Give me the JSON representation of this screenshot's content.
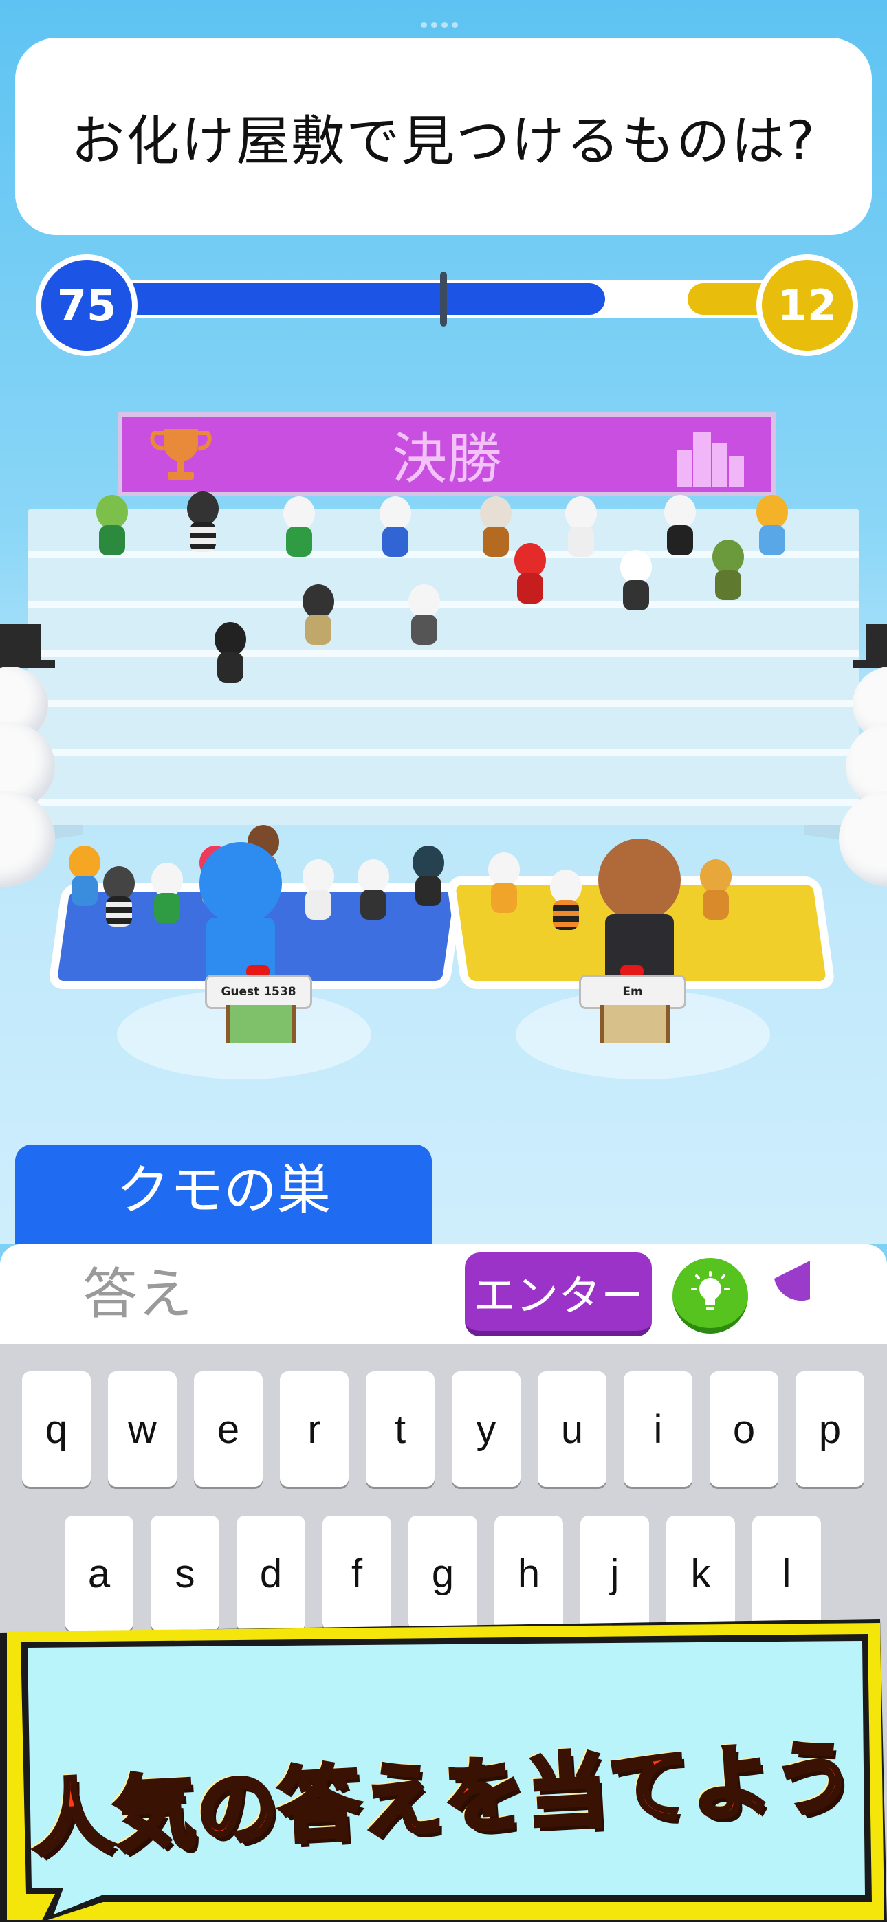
{
  "question": "お化け屋敷で見つけるものは?",
  "scores": {
    "blue": "75",
    "yellow": "12",
    "blue_fraction": 0.74,
    "yellow_fraction": 0.15
  },
  "stage_sign": "決勝",
  "players": {
    "left_name": "Guest 1538",
    "right_name": "Em"
  },
  "answer_tab": "クモの巣",
  "input": {
    "placeholder": "答え",
    "value": ""
  },
  "enter_button": "エンター",
  "keyboard": {
    "row1": [
      "q",
      "w",
      "e",
      "r",
      "t",
      "y",
      "u",
      "i",
      "o",
      "p"
    ],
    "row2": [
      "a",
      "s",
      "d",
      "f",
      "g",
      "h",
      "j",
      "k",
      "l"
    ]
  },
  "promo_text": "人気の答えを当てよう",
  "colors": {
    "blue_team": "#1c55e6",
    "yellow_team": "#e8bd0c",
    "enter": "#9b33c8",
    "hint": "#57c31f"
  },
  "icons": {
    "sign_left": "trophy-icon",
    "sign_right": "city-icon",
    "hint": "lightbulb-icon",
    "timer": "timer-icon"
  }
}
